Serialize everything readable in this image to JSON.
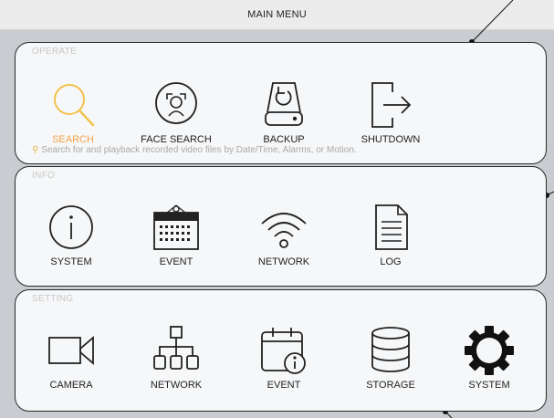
{
  "header": {
    "title": "MAIN MENU"
  },
  "colors": {
    "accent": "#f2a24a",
    "panel_bg": "#f6f7f8",
    "frame_bg": "#c9ccd0",
    "section_label": "#c7c7c7"
  },
  "operate": {
    "label": "OPERATE",
    "items": [
      {
        "label": "SEARCH",
        "icon": "magnifier-icon",
        "active": true
      },
      {
        "label": "FACE SEARCH",
        "icon": "face-search-icon"
      },
      {
        "label": "BACKUP",
        "icon": "backup-drive-icon"
      },
      {
        "label": "SHUTDOWN",
        "icon": "exit-arrow-icon"
      }
    ],
    "hint": "Search for and playback recorded video files by Date/Time, Alarms, or Motion."
  },
  "info": {
    "label": "INFO",
    "items": [
      {
        "label": "SYSTEM",
        "icon": "info-circle-icon"
      },
      {
        "label": "EVENT",
        "icon": "calendar-icon"
      },
      {
        "label": "NETWORK",
        "icon": "wifi-icon"
      },
      {
        "label": "LOG",
        "icon": "document-icon"
      }
    ]
  },
  "setting": {
    "label": "SETTING",
    "items": [
      {
        "label": "CAMERA",
        "icon": "video-camera-icon"
      },
      {
        "label": "NETWORK",
        "icon": "network-tree-icon"
      },
      {
        "label": "EVENT",
        "icon": "calendar-info-icon"
      },
      {
        "label": "STORAGE",
        "icon": "database-icon"
      },
      {
        "label": "SYSTEM",
        "icon": "gear-icon"
      }
    ]
  }
}
